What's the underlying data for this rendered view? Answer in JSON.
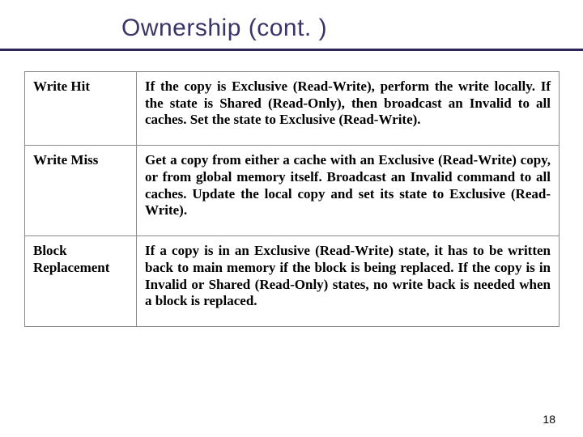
{
  "title": "Ownership (cont. )",
  "rows": [
    {
      "label": "Write Hit",
      "desc": "If the copy is Exclusive (Read-Write), perform the write locally. If the state is Shared (Read-Only), then broadcast an Invalid to all caches. Set the state to Exclusive (Read-Write)."
    },
    {
      "label": "Write Miss",
      "desc": "Get a copy from either a cache with an Exclusive (Read-Write) copy, or from global memory itself. Broadcast an Invalid command to all caches. Update the local copy and set its state to Exclusive (Read-Write)."
    },
    {
      "label": "Block Replacement",
      "desc": "If a copy is in an Exclusive (Read-Write) state, it has to be written back to main memory if the block is being replaced. If the copy is in Invalid or Shared (Read-Only) states, no write back is needed when a block is replaced."
    }
  ],
  "page_number": "18"
}
